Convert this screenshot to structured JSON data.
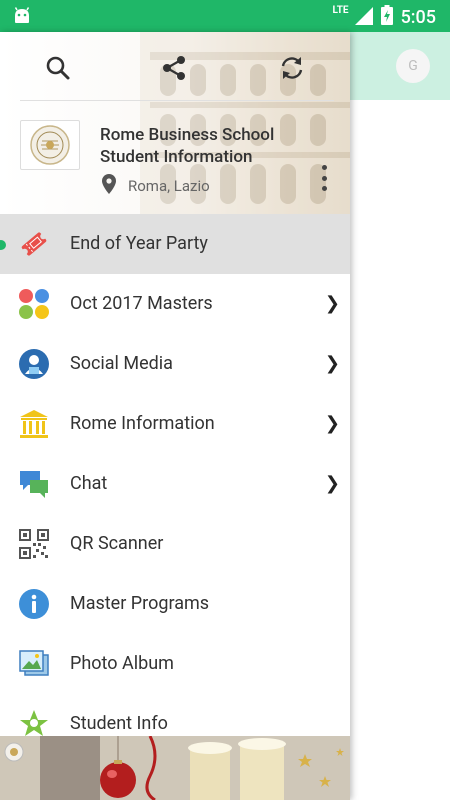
{
  "status_bar": {
    "network": "LTE",
    "time": "5:05",
    "bg_color": "#1fb768"
  },
  "background_app": {
    "avatar_initial": "G",
    "appbar_color": "#ccf0e1"
  },
  "drawer": {
    "toolbar": {
      "search_icon": "search-icon",
      "share_icon": "share-icon",
      "refresh_icon": "refresh-icon"
    },
    "header": {
      "title_line1": "Rome Business School",
      "title_line2": "Student Information",
      "location": "Roma, Lazio"
    },
    "menu": [
      {
        "label": "End of Year Party",
        "icon": "ticket-icon",
        "active": true,
        "has_chevron": false
      },
      {
        "label": "Oct 2017 Masters",
        "icon": "colored-dots-icon",
        "active": false,
        "has_chevron": true
      },
      {
        "label": "Social Media",
        "icon": "social-user-icon",
        "active": false,
        "has_chevron": true
      },
      {
        "label": "Rome Information",
        "icon": "columns-building-icon",
        "active": false,
        "has_chevron": true
      },
      {
        "label": "Chat",
        "icon": "chat-bubbles-icon",
        "active": false,
        "has_chevron": true
      },
      {
        "label": "QR Scanner",
        "icon": "qr-code-icon",
        "active": false,
        "has_chevron": false
      },
      {
        "label": "Master Programs",
        "icon": "info-icon",
        "active": false,
        "has_chevron": false
      },
      {
        "label": "Photo Album",
        "icon": "photo-album-icon",
        "active": false,
        "has_chevron": false
      },
      {
        "label": "Student Info",
        "icon": "student-star-icon",
        "active": false,
        "has_chevron": false
      }
    ],
    "chevron_glyph": "❯",
    "accent_color": "#1fb768"
  }
}
